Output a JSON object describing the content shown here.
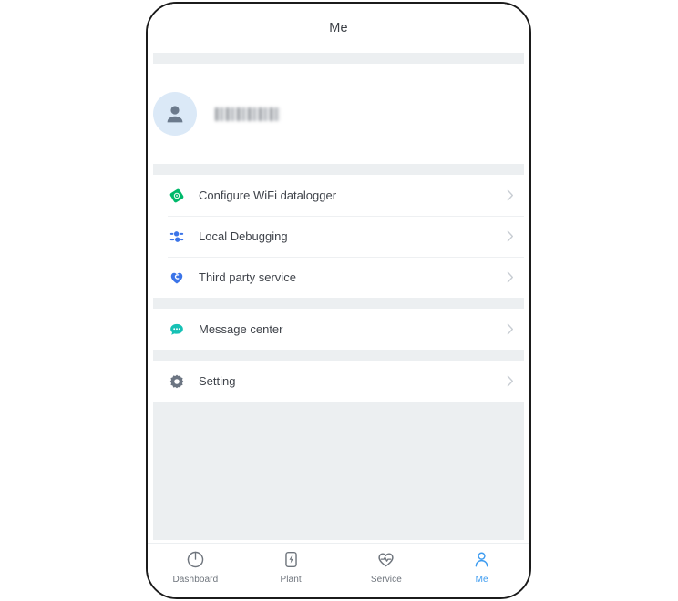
{
  "app": {
    "screen_title": "Me"
  },
  "profile": {
    "username": "",
    "username_redacted": true,
    "avatar_icon": "person-avatar-icon",
    "avatar_bg_color": "#dbe9f7",
    "avatar_fg_color": "#6b7a8c"
  },
  "colors": {
    "separator_band": "#eceff1",
    "page_background": "#ffffff",
    "primary_text": "#3f434a",
    "title_text": "#3b3f45",
    "chevron": "#c8cdd3",
    "active_tab": "#3c9bf0",
    "inactive_tab": "#6f757d",
    "icon_green": "#00b96b",
    "icon_blue": "#3b74e8",
    "icon_teal": "#16c1b5",
    "icon_gray": "#6c7582"
  },
  "menu_groups": [
    {
      "group_id": "device-group",
      "items": [
        {
          "id": "configure-wifi-datalogger",
          "label": "Configure WiFi datalogger",
          "icon": "wifi-datalogger-icon",
          "icon_color": "#00b96b",
          "chevron": "chevron-right-icon"
        },
        {
          "id": "local-debugging",
          "label": "Local Debugging",
          "icon": "sliders-icon",
          "icon_color": "#3b74e8",
          "chevron": "chevron-right-icon"
        },
        {
          "id": "third-party-service",
          "label": "Third party service",
          "icon": "link-heart-icon",
          "icon_color": "#3b74e8",
          "chevron": "chevron-right-icon"
        }
      ]
    },
    {
      "group_id": "message-group",
      "items": [
        {
          "id": "message-center",
          "label": "Message center",
          "icon": "chat-bubble-icon",
          "icon_color": "#16c1b5",
          "chevron": "chevron-right-icon"
        }
      ]
    },
    {
      "group_id": "setting-group",
      "items": [
        {
          "id": "setting",
          "label": "Setting",
          "icon": "gear-icon",
          "icon_color": "#6c7582",
          "chevron": "chevron-right-icon"
        }
      ]
    }
  ],
  "tabbar": {
    "tabs": [
      {
        "id": "dashboard",
        "label": "Dashboard",
        "icon": "gauge-icon",
        "active": false
      },
      {
        "id": "plant",
        "label": "Plant",
        "icon": "plant-power-icon",
        "active": false
      },
      {
        "id": "service",
        "label": "Service",
        "icon": "heart-pulse-icon",
        "active": false
      },
      {
        "id": "me",
        "label": "Me",
        "icon": "person-icon",
        "active": true
      }
    ]
  }
}
